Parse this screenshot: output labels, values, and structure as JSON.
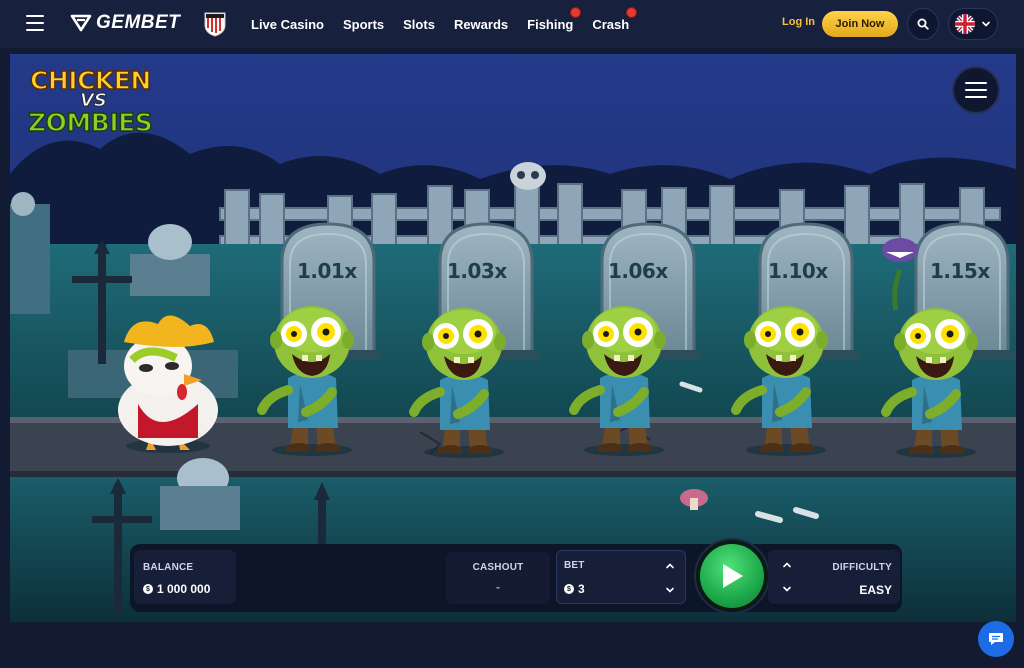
{
  "nav": {
    "logo_text": "GEMBET",
    "items": [
      "Live Casino",
      "Sports",
      "Slots",
      "Rewards",
      "Fishing",
      "Crash"
    ],
    "login": "Log In",
    "join": "Join Now"
  },
  "game": {
    "logo": {
      "line1": "CHICKEN",
      "vs": "VS",
      "line2": "ZOMBIES"
    },
    "multipliers": [
      "1.01x",
      "1.03x",
      "1.06x",
      "1.10x",
      "1.15x"
    ]
  },
  "controls": {
    "balance_label": "BALANCE",
    "balance_value": "1 000 000",
    "cashout_label": "CASHOUT",
    "cashout_value": "-",
    "bet_label": "BET",
    "bet_value": "3",
    "difficulty_label": "DIFFICULTY",
    "difficulty_value": "EASY"
  },
  "colors": {
    "accent": "#f6c244",
    "play": "#22b24f",
    "nav_bg": "#17203d",
    "chat": "#1e6be6"
  }
}
